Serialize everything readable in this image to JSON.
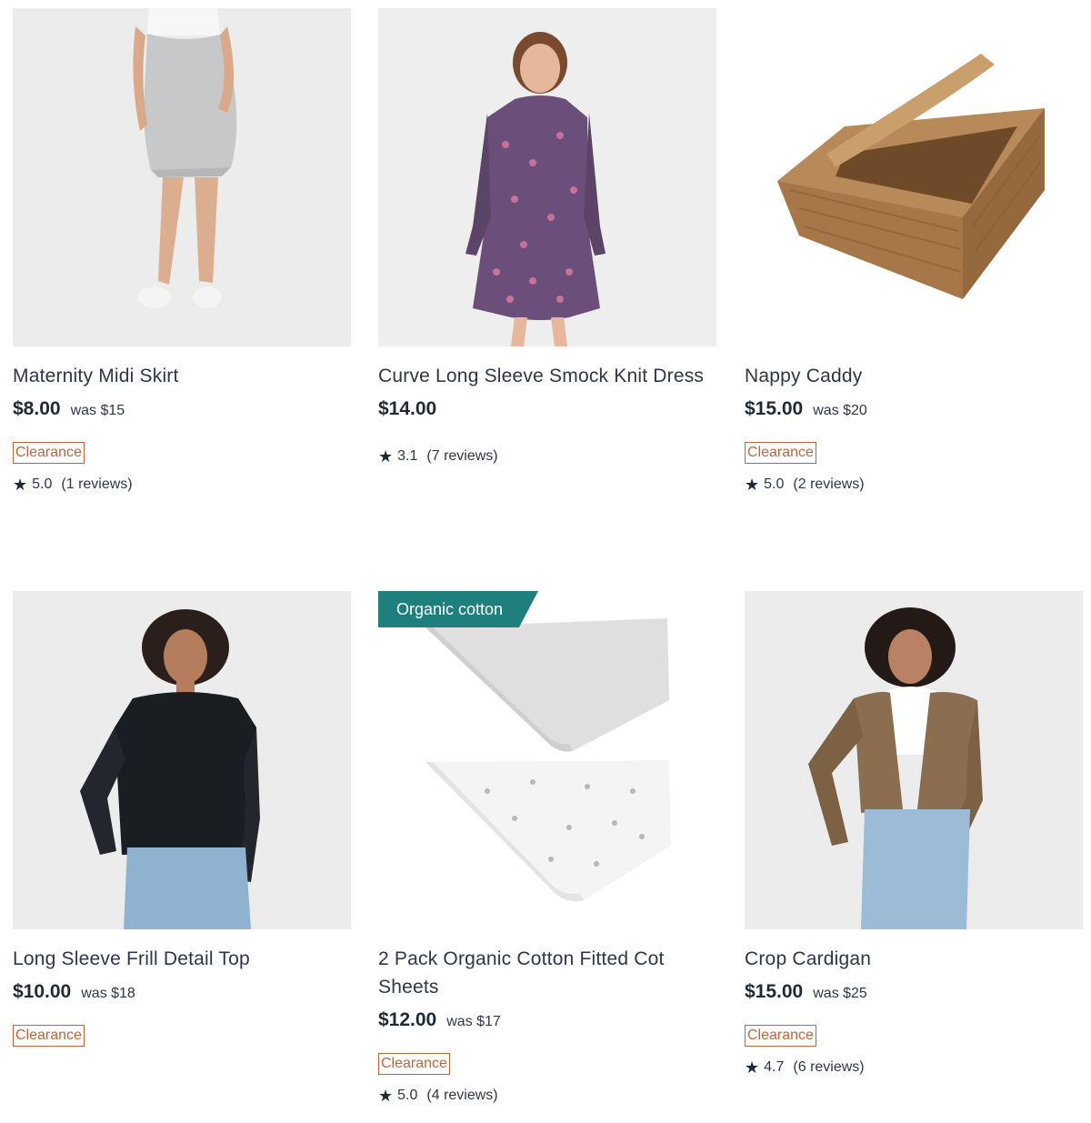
{
  "products": [
    {
      "title": "Maternity Midi Skirt",
      "price": "$8.00",
      "was": "was $15",
      "badge_label": "Clearance",
      "rating": "5.0",
      "reviews": "(1 reviews)",
      "image": "skirt-photo"
    },
    {
      "title": "Curve Long Sleeve Smock Knit Dress",
      "price": "$14.00",
      "rating": "3.1",
      "reviews": "(7 reviews)",
      "image": "dress-photo"
    },
    {
      "title": "Nappy Caddy",
      "price": "$15.00",
      "was": "was $20",
      "badge_label": "Clearance",
      "rating": "5.0",
      "reviews": "(2 reviews)",
      "image": "basket-photo"
    },
    {
      "title": "Long Sleeve Frill Detail Top",
      "price": "$10.00",
      "was": "was $18",
      "badge_label": "Clearance",
      "image": "top-photo"
    },
    {
      "title": "2 Pack Organic Cotton Fitted Cot Sheets",
      "price": "$12.00",
      "was": "was $17",
      "badge_label": "Clearance",
      "rating": "5.0",
      "reviews": "(4 reviews)",
      "promo_tag": "Organic cotton",
      "image": "sheets-photo"
    },
    {
      "title": "Crop Cardigan",
      "price": "$15.00",
      "was": "was $25",
      "badge_label": "Clearance",
      "rating": "4.7",
      "reviews": "(6 reviews)",
      "image": "cardigan-photo"
    }
  ],
  "colors": {
    "clearance": "#c0653a",
    "promo_tag_bg": "#1e7f7c",
    "image_bg": "#eeeeee",
    "text": "#2d3748"
  },
  "icons": {
    "rating": "star-icon"
  }
}
